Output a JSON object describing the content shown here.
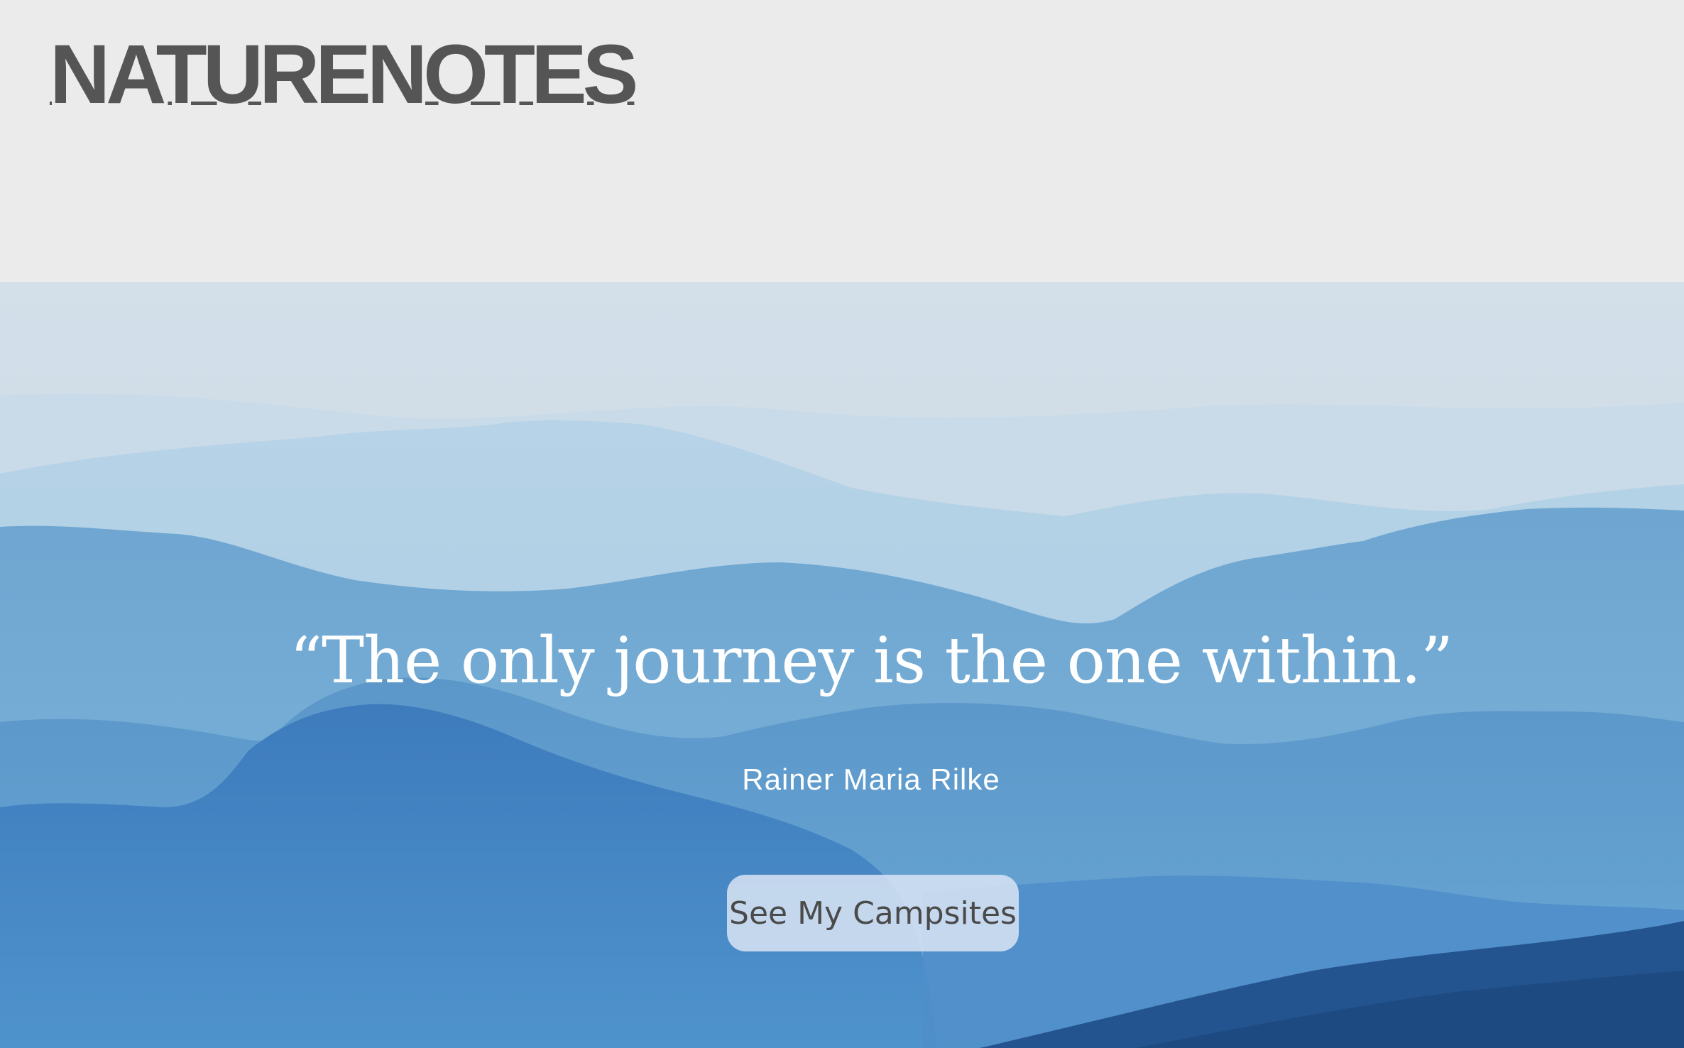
{
  "header": {
    "logo_text": "NATURENOTES"
  },
  "hero": {
    "background_image": "misty-blue-mountain-ridges",
    "quote": "“The only journey is the one within.”",
    "author": "Rainer Maria Rilke",
    "cta_label": "See My Campsites"
  },
  "colors": {
    "header_bg": "#ebebeb",
    "logo": "#555555",
    "hero_text": "#ffffff",
    "button_bg": "#d5e1f3",
    "button_text": "#4a4a4a"
  }
}
